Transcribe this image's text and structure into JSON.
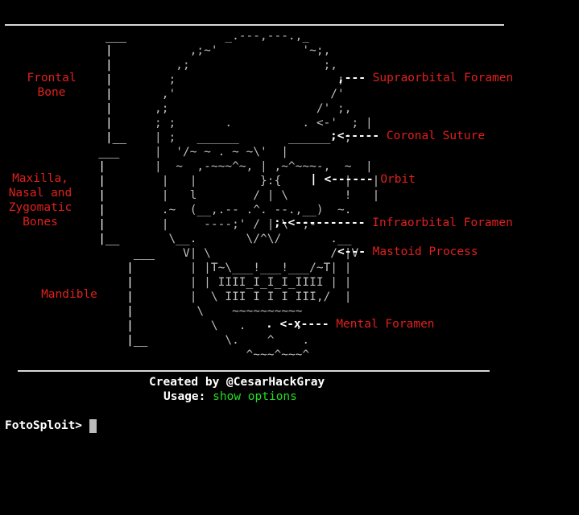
{
  "skull_art": "                                _.---,---.,_\n                           ,;~'            '~;,\n                         ,;                   ;,\n                        ;                       ;\n                       ,'                      /'\n                      ,;                     /' ;,\n                      ; ;       .          . <-'  ; |\n                      | ;   ______       ______  ;\n                      |  '/~ ~ . ~ ~\\'  |\n                      |  ~  ,-~~~^~, | ,~^~~~-,  ~  |\n                       |   |         }:{         |   |\n                       |   l        / | \\        !   |\n                       .~  (__,.-- .^. --.,__)  ~.\n                       |     ----;' / | \\  ;-\n                        \\__.       \\/^\\/       .__\n                          V| \\                 / |V\n                           | |T~\\___!___!___/~T| |\n                           | | IIII_I_I_I_IIII | |\n                           |  \\ III I I I III,/  |\n                            \\    ~~~~~~~~~~\n                              \\   .       .\n                                \\.    ^    .\n                                   ^~~~^~~~^",
  "bracket_art": "               ___\n               |\n               |\n               |\n               |\n               |\n               |\n               |__\n              ___\n              |\n              |\n              |\n              |\n              |\n              |__\n                   ___\n                  |\n                  |\n                  |\n                  |\n                  |\n                  |__",
  "left_labels": {
    "frontal": "Frontal\nBone",
    "maxilla": "Maxilla,\nNasal and\nZygomatic\nBones",
    "mandible": "Mandible"
  },
  "pointers": {
    "supraorbital": {
      "arrow": ",---",
      "name": "Supraorbital Foramen"
    },
    "coronal": {
      "arrow": ";<-----",
      "name": "Coronal Suture"
    },
    "orbit": {
      "arrow": "| <------",
      "name": "Orbit"
    },
    "infraorbital": {
      "arrow": ";-<----------",
      "name": "Infraorbital Foramen"
    },
    "mastoid": {
      "arrow": "<---",
      "name": "Mastoid Process"
    },
    "mental": {
      "arrow": ". <-x----",
      "name": "Mental Foramen"
    }
  },
  "credits": {
    "created_by": "Created by @CesarHackGray",
    "usage_label": "Usage:",
    "usage_command": "show options"
  },
  "prompt": "FotoSploit>",
  "colors": {
    "background": "#000000",
    "art": "#bdbdbd",
    "labels": "#e0201c",
    "command": "#22dd22",
    "rule": "#d8d8d8"
  }
}
